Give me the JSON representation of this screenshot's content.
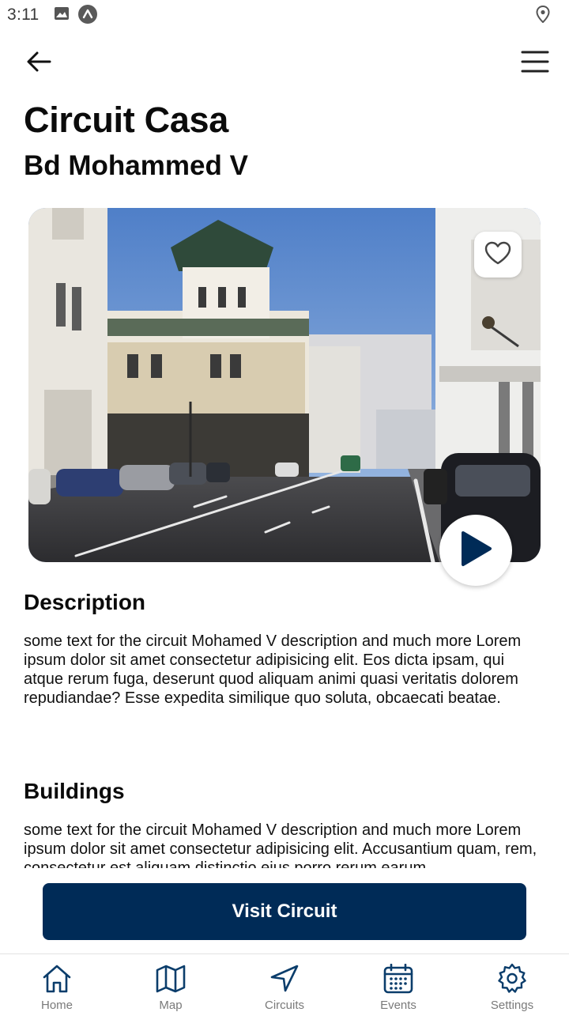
{
  "status_bar": {
    "time": "3:11",
    "icons": [
      "image-icon",
      "app-notification-icon",
      "location-pin-icon"
    ]
  },
  "header": {
    "back_icon": "arrow-left-icon",
    "menu_icon": "hamburger-menu-icon"
  },
  "circuit": {
    "title": "Circuit Casa",
    "subtitle": "Bd Mohammed V",
    "image_alt": "street-photo"
  },
  "actions": {
    "favorite_icon": "heart-outline-icon",
    "play_icon": "play-icon"
  },
  "description": {
    "heading": "Description",
    "text": "some text for the circuit Mohamed V description and much more Lorem ipsum dolor sit amet consectetur adipisicing elit. Eos dicta ipsam, qui atque rerum fuga, deserunt quod aliquam animi quasi veritatis dolorem repudiandae? Esse expedita similique quo soluta, obcaecati beatae."
  },
  "buildings": {
    "heading": "Buildings",
    "text": "some text for the circuit Mohamed V description and much more Lorem ipsum dolor sit amet consectetur adipisicing elit. Accusantium quam, rem, consectetur est aliquam distinctio eius porro rerum earum"
  },
  "cta": {
    "label": "Visit Circuit"
  },
  "bottom_nav": {
    "items": [
      {
        "label": "Home",
        "icon": "home-icon"
      },
      {
        "label": "Map",
        "icon": "map-icon"
      },
      {
        "label": "Circuits",
        "icon": "navigation-arrow-icon"
      },
      {
        "label": "Events",
        "icon": "calendar-icon"
      },
      {
        "label": "Settings",
        "icon": "gear-icon"
      }
    ]
  },
  "colors": {
    "primary": "#002b57",
    "nav_icon": "#0b3d6b",
    "nav_label": "#7a7a7a",
    "text": "#111111"
  }
}
